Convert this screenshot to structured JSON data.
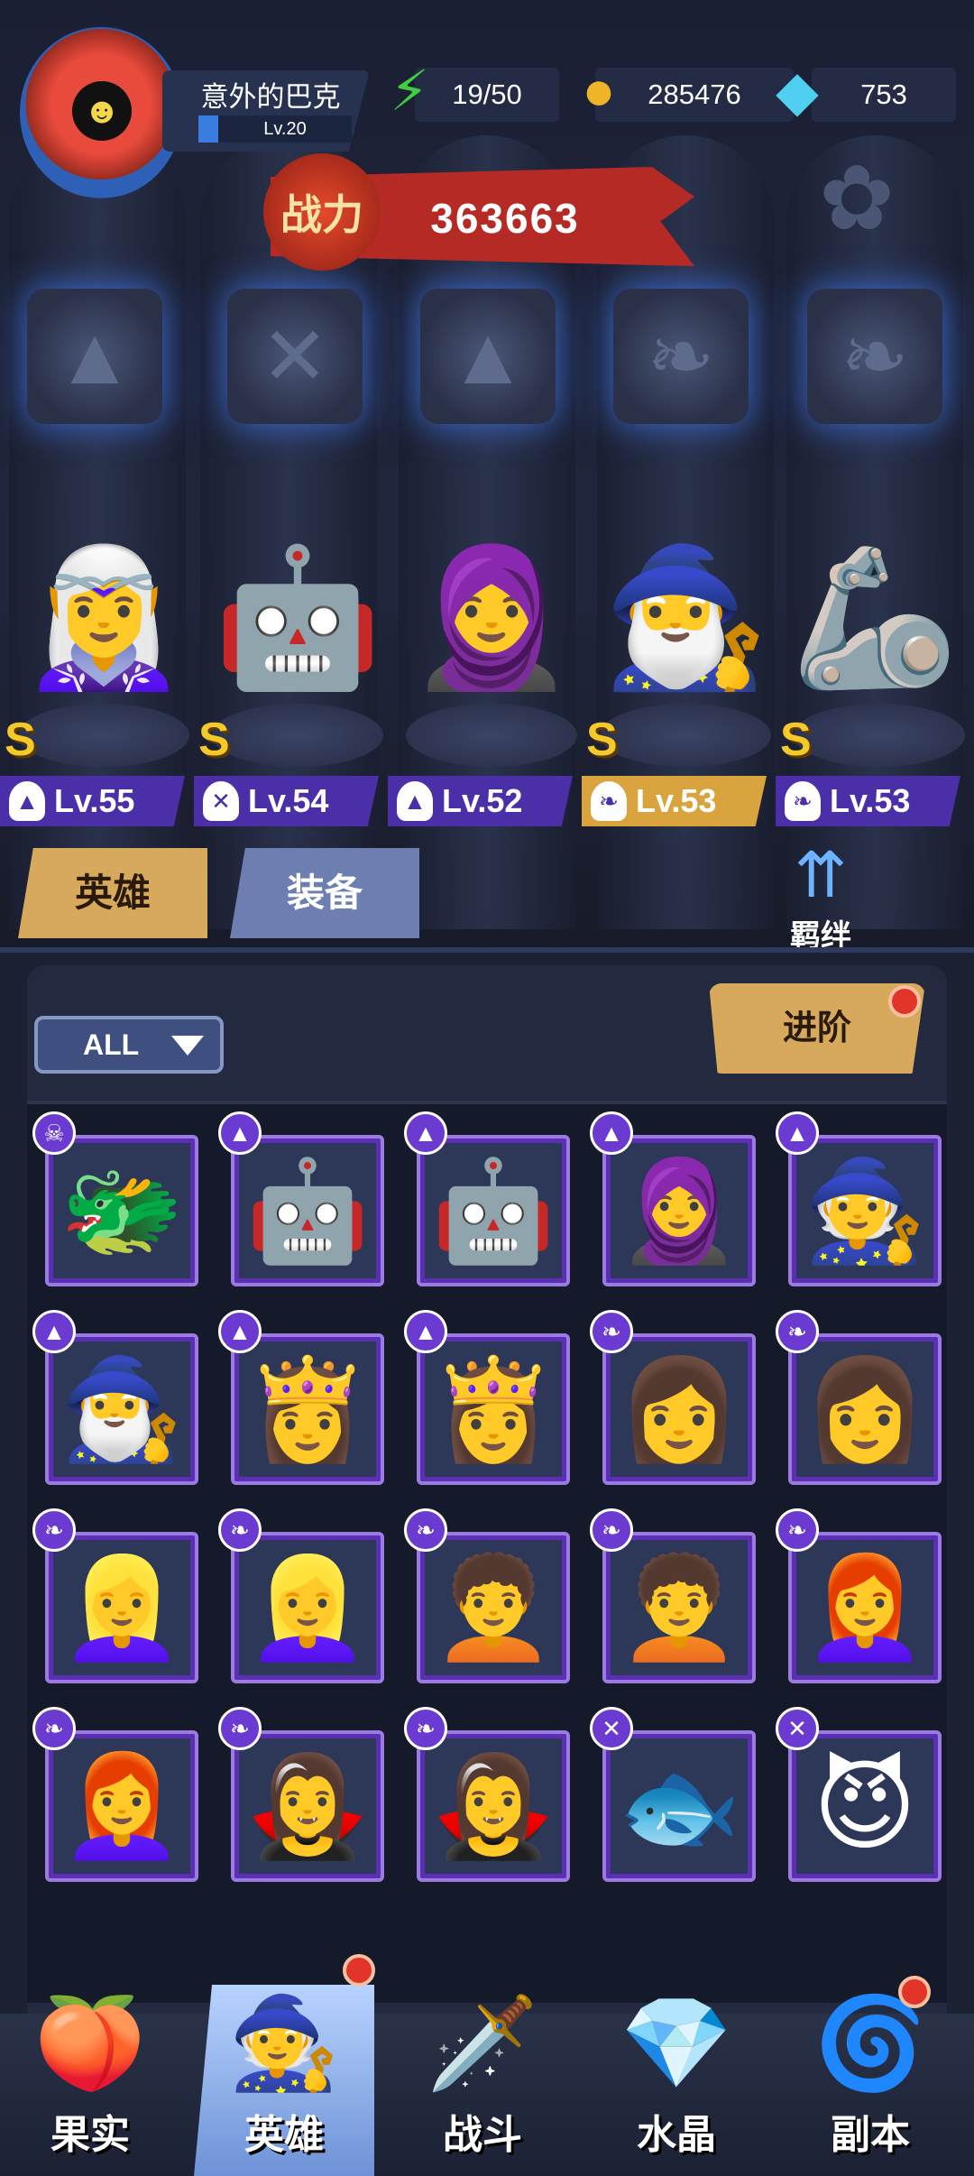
{
  "player": {
    "name": "意外的巴克",
    "level": "Lv.20"
  },
  "resources": {
    "energy": "19/50",
    "gold": "285476",
    "gems": "753"
  },
  "power": {
    "label": "战力",
    "value": "363663"
  },
  "heroes": [
    {
      "rank": "S",
      "level": "Lv.55",
      "class_icon": "mage-hat-icon",
      "emoji": "🧝‍♀️"
    },
    {
      "rank": "S",
      "level": "Lv.54",
      "class_icon": "wrench-icon",
      "emoji": "🤖"
    },
    {
      "rank": "",
      "level": "Lv.52",
      "class_icon": "mage-hat-icon",
      "emoji": "🧕"
    },
    {
      "rank": "S",
      "level": "Lv.53",
      "class_icon": "wing-icon",
      "emoji": "🧙‍♂️"
    },
    {
      "rank": "S",
      "level": "Lv.53",
      "class_icon": "wing-icon",
      "emoji": "🦾"
    }
  ],
  "tabs": {
    "heroes": "英雄",
    "equipment": "装备"
  },
  "bond_label": "羁绊",
  "filter": {
    "selected": "ALL"
  },
  "advance_label": "进阶",
  "nav": {
    "fruit": "果实",
    "hero": "英雄",
    "battle": "战斗",
    "crystal": "水晶",
    "dungeon": "副本"
  },
  "roster": [
    "🐲",
    "🤖",
    "🤖",
    "🧕",
    "🧙",
    "🧙‍♂️",
    "👸",
    "👸",
    "👩",
    "👩",
    "👱‍♀️",
    "👱‍♀️",
    "🧑‍🦱",
    "🧑‍🦱",
    "👩‍🦰",
    "👩‍🦰",
    "🧛‍♀️",
    "🧛‍♀️",
    "🐟",
    "😈"
  ],
  "roster_badges": [
    "demon",
    "mage",
    "mage",
    "mage",
    "mage",
    "mage",
    "mage",
    "mage",
    "wing",
    "wing",
    "wing",
    "wing",
    "wing",
    "wing",
    "wing",
    "wing",
    "wing",
    "wing",
    "wrench",
    "wrench"
  ],
  "colors": {
    "accent_purple": "#5b2fb4",
    "banner_red": "#b62a26",
    "gold": "#d6a95c"
  }
}
